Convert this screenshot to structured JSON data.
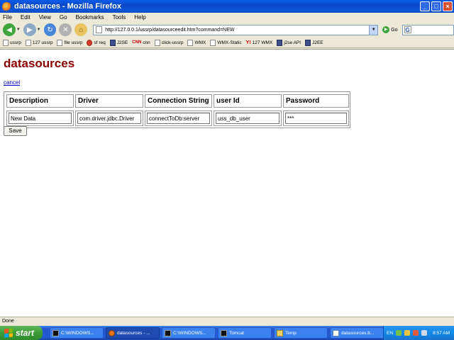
{
  "window": {
    "title": "datasources - Mozilla Firefox",
    "controls": {
      "minimize": "_",
      "maximize": "□",
      "close": "×"
    }
  },
  "menu": [
    "File",
    "Edit",
    "View",
    "Go",
    "Bookmarks",
    "Tools",
    "Help"
  ],
  "nav": {
    "url": "http://127.0.0.1/ussrp/datasourceedit.htm?command=NEW",
    "go_label": "Go"
  },
  "bookmarks": [
    {
      "label": "ussrp",
      "icon": "page-icon"
    },
    {
      "label": "127 ussrp",
      "icon": "page-icon"
    },
    {
      "label": "file ussrp",
      "icon": "page-icon"
    },
    {
      "label": "sf req",
      "icon": "red-circle-icon"
    },
    {
      "label": "J2SE",
      "icon": "java-icon"
    },
    {
      "label": "cnn",
      "icon": "cnn-icon"
    },
    {
      "label": "click-ussrp",
      "icon": "page-icon"
    },
    {
      "label": "WMX",
      "icon": "page-icon"
    },
    {
      "label": "WMX-Static",
      "icon": "page-icon"
    },
    {
      "label": "127 WMX",
      "icon": "y-icon"
    },
    {
      "label": "j2se API",
      "icon": "java-icon"
    },
    {
      "label": "J2EE",
      "icon": "java-icon"
    }
  ],
  "page": {
    "heading": "datasources",
    "cancel_label": "cancel",
    "save_label": "Save",
    "table": {
      "headers": [
        "Description",
        "Driver",
        "Connection String",
        "user Id",
        "Password"
      ],
      "values": [
        "New Data",
        "com.driver.jdbc.Driver",
        "connectToDb:server",
        "uss_db_user",
        "***"
      ]
    }
  },
  "status": {
    "text": "Done"
  },
  "taskbar": {
    "start_label": "start",
    "tasks": [
      {
        "label": "C:\\WINDOWS...",
        "icon": "cmd-icon",
        "active": false
      },
      {
        "label": "datasources - ...",
        "icon": "firefox-icon",
        "active": true
      },
      {
        "label": "C:\\WINDOWS...",
        "icon": "cmd-icon",
        "active": false
      },
      {
        "label": "Tomcat",
        "icon": "cmd-icon",
        "active": false
      },
      {
        "label": "Temp",
        "icon": "folder-icon",
        "active": false
      },
      {
        "label": "datasources.b...",
        "icon": "document-icon",
        "active": false
      }
    ],
    "tray": {
      "lang": "EN",
      "clock": "8:57 AM"
    }
  }
}
